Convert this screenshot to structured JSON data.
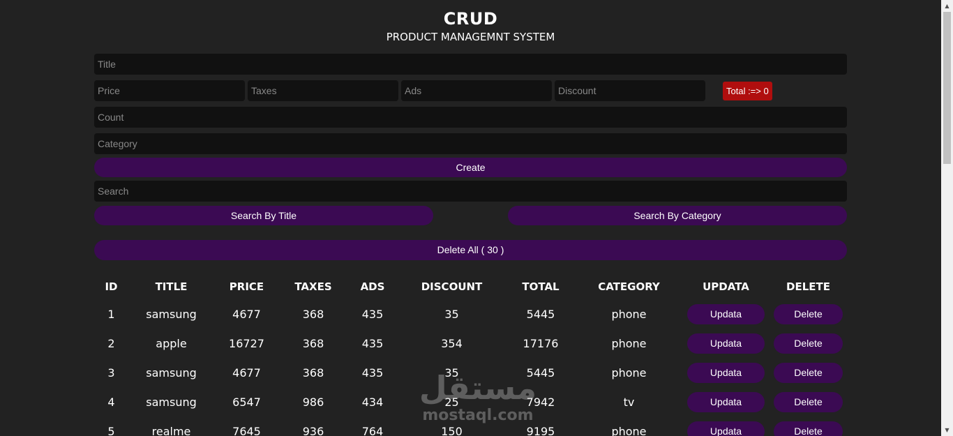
{
  "header": {
    "title": "CRUD",
    "subtitle": "PRODUCT MANAGEMNT SYSTEM"
  },
  "form": {
    "title_placeholder": "Title",
    "price_placeholder": "Price",
    "taxes_placeholder": "Taxes",
    "ads_placeholder": "Ads",
    "discount_placeholder": "Discount",
    "total_label": "Total :=> 0",
    "count_placeholder": "Count",
    "category_placeholder": "Category",
    "create_label": "Create"
  },
  "search": {
    "placeholder": "Search",
    "by_title_label": "Search By Title",
    "by_category_label": "Search By Category"
  },
  "delete_all_label": "Delete All ( 30 )",
  "table": {
    "headers": [
      "ID",
      "TITLE",
      "PRICE",
      "TAXES",
      "ADS",
      "DISCOUNT",
      "TOTAL",
      "CATEGORY",
      "UPDATA",
      "DELETE"
    ],
    "update_label": "Updata",
    "delete_label": "Delete",
    "rows": [
      {
        "id": "1",
        "title": "samsung",
        "price": "4677",
        "taxes": "368",
        "ads": "435",
        "discount": "35",
        "total": "5445",
        "category": "phone"
      },
      {
        "id": "2",
        "title": "apple",
        "price": "16727",
        "taxes": "368",
        "ads": "435",
        "discount": "354",
        "total": "17176",
        "category": "phone"
      },
      {
        "id": "3",
        "title": "samsung",
        "price": "4677",
        "taxes": "368",
        "ads": "435",
        "discount": "35",
        "total": "5445",
        "category": "phone"
      },
      {
        "id": "4",
        "title": "samsung",
        "price": "6547",
        "taxes": "986",
        "ads": "434",
        "discount": "25",
        "total": "7942",
        "category": "tv"
      },
      {
        "id": "5",
        "title": "realme",
        "price": "7645",
        "taxes": "936",
        "ads": "764",
        "discount": "150",
        "total": "9195",
        "category": "phone"
      }
    ]
  },
  "watermark": {
    "arabic": "مستقل",
    "latin": "mostaql.com"
  },
  "colors": {
    "background": "#222222",
    "input_background": "#111111",
    "button_purple": "#3b0a53",
    "total_red": "#b00e0e"
  },
  "icons": {
    "scroll_up": "scroll-up-arrow-icon",
    "scroll_down": "scroll-down-arrow-icon"
  }
}
